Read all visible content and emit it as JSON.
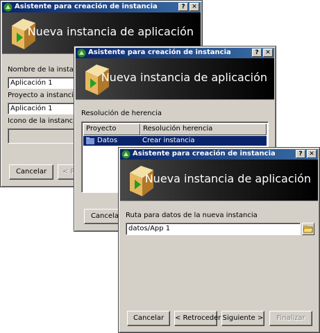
{
  "dialog1": {
    "title": "Asistente para creación de instancia",
    "banner_title": "Nueva instancia de aplicación",
    "instance_name_label": "Nombre de la instancia:",
    "instance_name_value": "Aplicación 1",
    "project_label": "Proyecto a instanciar:",
    "project_value": "Aplicación 1",
    "icon_label": "Icono de la instancia:",
    "cancel_label": "Cancelar",
    "back_label": "< Re"
  },
  "dialog2": {
    "title": "Asistente para creación de instancia",
    "banner_title": "Nueva instancia de aplicación",
    "section_label": "Resolución de herencia",
    "columns": [
      "Proyecto",
      "Resolución herencia"
    ],
    "rows": [
      {
        "project": "Datos",
        "resolution": "Crear instancia"
      }
    ],
    "cancel_label": "Cancelar"
  },
  "dialog3": {
    "title": "Asistente para creación de instancia",
    "banner_title": "Nueva instancia de aplicación",
    "path_label": "Ruta para datos de la nueva instancia",
    "path_value": "datos/App 1",
    "cancel_label": "Cancelar",
    "back_label": "< Retroceder",
    "next_label": "Siguiente >",
    "finish_label": "Finalizar"
  },
  "titlebar_buttons": {
    "help": "?",
    "close": "✕"
  },
  "icons": [
    "app-icon",
    "help-icon",
    "close-icon",
    "wizard-logo-icon",
    "folder-icon",
    "table-row-icon",
    "browse-folder-icon"
  ],
  "colors": {
    "titlebar": "#0a246a",
    "selection": "#0a246a",
    "face": "#d4d0c8"
  }
}
